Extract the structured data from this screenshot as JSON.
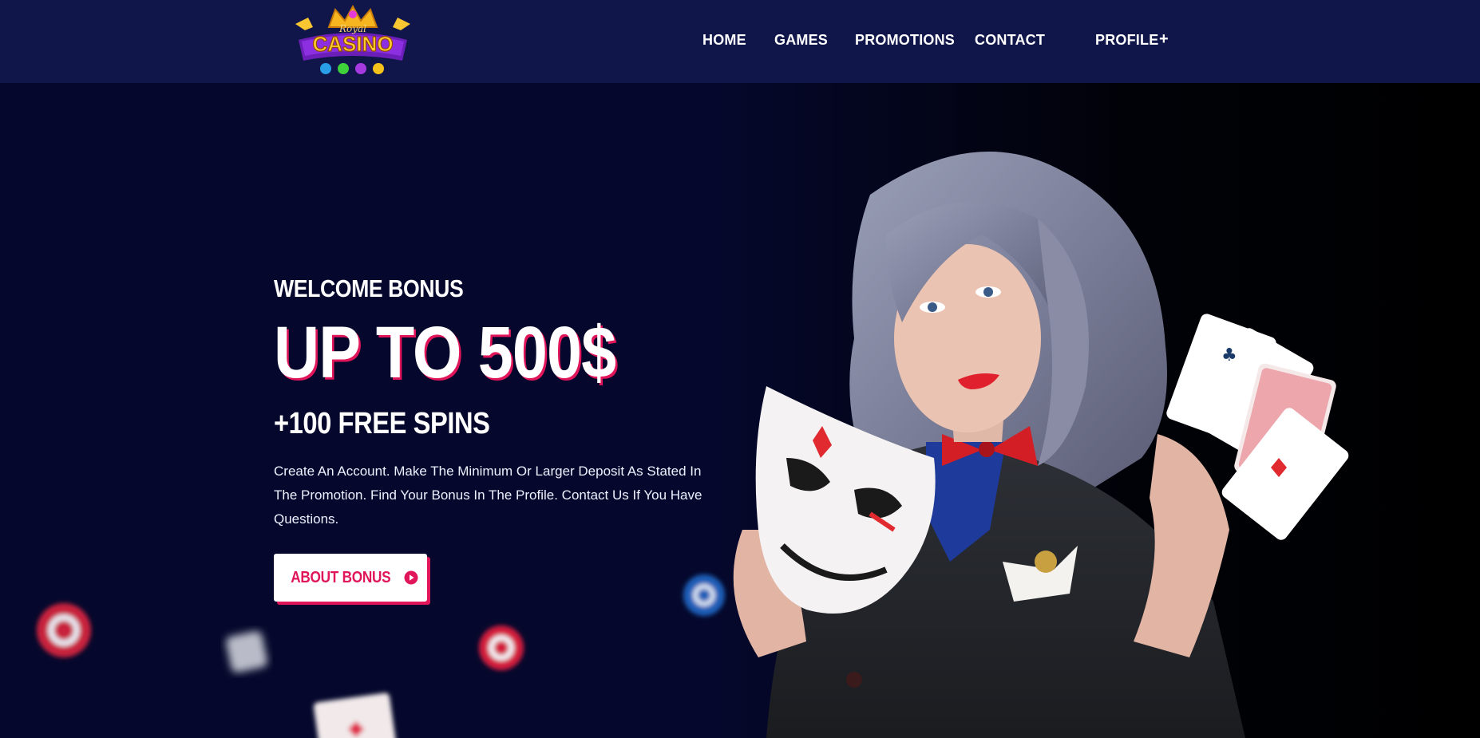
{
  "header": {
    "logo": {
      "name": "royal-casino-logo",
      "text_top": "Royal",
      "text_main": "CASINO"
    },
    "nav": [
      {
        "label": "HOME",
        "icon": ""
      },
      {
        "label": "GAMES",
        "icon": ""
      },
      {
        "label": "PROMOTIONS",
        "icon": ""
      },
      {
        "label": "CONTACT",
        "icon": ""
      },
      {
        "label": "PROFILE",
        "icon": "plus-icon"
      }
    ],
    "profile_toggle": "+"
  },
  "hero": {
    "eyebrow": "WELCOME BONUS",
    "headline": "UP TO 500$",
    "subhead": "+100 FREE SPINS",
    "description": "Create An Account. Make The Minimum Or Larger Deposit As Stated In The Promotion. Find Your Bonus In The Profile. Contact Us If You Have Questions.",
    "cta": {
      "label": "ABOUT BONUS",
      "icon": "play-circle-icon"
    },
    "image": "woman-with-mask-and-cards-photo"
  },
  "colors": {
    "header_bg": "#11164a",
    "hero_bg": "#05072a",
    "accent": "#e0155a",
    "text": "#ffffff"
  }
}
